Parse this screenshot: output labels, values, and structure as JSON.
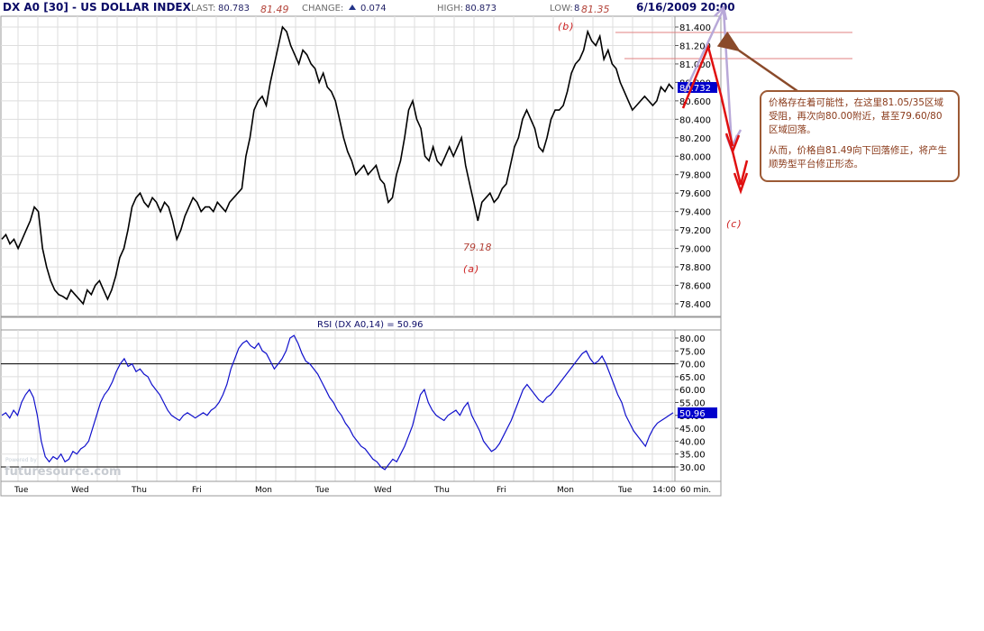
{
  "header": {
    "symbol": "DX A0 [30] - US DOLLAR INDEX",
    "last_label": "LAST:",
    "last_value": "80.783",
    "change_label": "CHANGE:",
    "change_value": "0.074",
    "high_label": "HIGH:",
    "high_value": "80.873",
    "low_label": "LOW:",
    "low_value": "8",
    "datetime": "6/16/2009 20:00"
  },
  "annotations": {
    "peak_high": "81.49",
    "peak_b": "81.35",
    "trough_low": "79.18",
    "wave_a": "(a)",
    "wave_b": "(b)",
    "wave_c": "(c)"
  },
  "note": {
    "paragraph1": "价格存在着可能性，在这里81.05/35区域受阻，再次向80.00附近，甚至79.60/80区域回落。",
    "paragraph2": "从而，价格自81.49向下回落修正，将产生顺势型平台修正形态。"
  },
  "watermark": "futuresource.com",
  "watermark_small": "Powered by",
  "interval_label": "60 min.",
  "colors": {
    "price": "#000000",
    "rsi": "#1010cc",
    "accent_box": "#0000cc",
    "annotation": "#cc2020",
    "note_border": "#9c5a35",
    "forecast_arrow": "#b8a8d8"
  },
  "chart_data": [
    {
      "type": "line",
      "name": "DX A0 price",
      "title": "DX A0 [30] - US DOLLAR INDEX",
      "yticks": [
        "81.400",
        "81.200",
        "81.000",
        "80.800",
        "80.600",
        "80.400",
        "80.200",
        "80.000",
        "79.800",
        "79.600",
        "79.400",
        "79.200",
        "79.000",
        "78.800",
        "78.600",
        "78.400"
      ],
      "ylim": [
        78.3,
        81.5
      ],
      "last_marker": "80.732",
      "x_labels": [
        "Tue",
        "Wed",
        "Thu",
        "Fri",
        "Mon",
        "Tue",
        "Wed",
        "Thu",
        "Fri",
        "Mon",
        "Tue",
        "14:00"
      ],
      "values": [
        79.1,
        79.15,
        79.05,
        79.1,
        79.0,
        79.1,
        79.2,
        79.3,
        79.45,
        79.4,
        79.0,
        78.8,
        78.65,
        78.55,
        78.5,
        78.48,
        78.45,
        78.55,
        78.5,
        78.45,
        78.4,
        78.55,
        78.5,
        78.6,
        78.65,
        78.55,
        78.45,
        78.55,
        78.7,
        78.9,
        79.0,
        79.2,
        79.45,
        79.55,
        79.6,
        79.5,
        79.45,
        79.55,
        79.5,
        79.4,
        79.5,
        79.45,
        79.3,
        79.1,
        79.2,
        79.35,
        79.45,
        79.55,
        79.5,
        79.4,
        79.45,
        79.45,
        79.4,
        79.5,
        79.45,
        79.4,
        79.5,
        79.55,
        79.6,
        79.65,
        80.0,
        80.2,
        80.5,
        80.6,
        80.65,
        80.55,
        80.8,
        81.0,
        81.2,
        81.4,
        81.35,
        81.2,
        81.1,
        81.0,
        81.15,
        81.1,
        81.0,
        80.95,
        80.8,
        80.9,
        80.75,
        80.7,
        80.6,
        80.4,
        80.2,
        80.05,
        79.95,
        79.8,
        79.85,
        79.9,
        79.8,
        79.85,
        79.9,
        79.75,
        79.7,
        79.5,
        79.55,
        79.8,
        79.95,
        80.2,
        80.5,
        80.6,
        80.4,
        80.3,
        80.0,
        79.95,
        80.1,
        79.95,
        79.9,
        80.0,
        80.1,
        80.0,
        80.1,
        80.2,
        79.9,
        79.7,
        79.5,
        79.3,
        79.5,
        79.55,
        79.6,
        79.5,
        79.55,
        79.65,
        79.7,
        79.9,
        80.1,
        80.2,
        80.4,
        80.5,
        80.4,
        80.3,
        80.1,
        80.05,
        80.2,
        80.4,
        80.5,
        80.5,
        80.55,
        80.7,
        80.9,
        81.0,
        81.05,
        81.15,
        81.35,
        81.25,
        81.2,
        81.3,
        81.05,
        81.15,
        81.0,
        80.95,
        80.8,
        80.7,
        80.6,
        80.5,
        80.55,
        80.6,
        80.65,
        80.6,
        80.55,
        80.6,
        80.75,
        80.7,
        80.78,
        80.73
      ]
    },
    {
      "type": "line",
      "name": "RSI (DX A0,14)",
      "title": "RSI (DX A0,14) = 50.96",
      "yticks": [
        "80.00",
        "75.00",
        "70.00",
        "65.00",
        "60.00",
        "55.00",
        "50.00",
        "45.00",
        "40.00",
        "35.00",
        "30.00"
      ],
      "ylim": [
        27,
        82
      ],
      "reference_lines": [
        70,
        30
      ],
      "last_marker": "50.96",
      "values": [
        50,
        51,
        49,
        52,
        50,
        55,
        58,
        60,
        57,
        50,
        40,
        34,
        32,
        34,
        33,
        35,
        32,
        33,
        36,
        35,
        37,
        38,
        40,
        45,
        50,
        55,
        58,
        60,
        63,
        67,
        70,
        72,
        69,
        70,
        67,
        68,
        66,
        65,
        62,
        60,
        58,
        55,
        52,
        50,
        49,
        48,
        50,
        51,
        50,
        49,
        50,
        51,
        50,
        52,
        53,
        55,
        58,
        62,
        68,
        72,
        76,
        78,
        79,
        77,
        76,
        78,
        75,
        74,
        71,
        68,
        70,
        72,
        75,
        80,
        81,
        78,
        74,
        71,
        70,
        68,
        66,
        63,
        60,
        57,
        55,
        52,
        50,
        47,
        45,
        42,
        40,
        38,
        37,
        35,
        33,
        32,
        30,
        29,
        31,
        33,
        32,
        35,
        38,
        42,
        46,
        52,
        58,
        60,
        55,
        52,
        50,
        49,
        48,
        50,
        51,
        52,
        50,
        53,
        55,
        50,
        47,
        44,
        40,
        38,
        36,
        37,
        39,
        42,
        45,
        48,
        52,
        56,
        60,
        62,
        60,
        58,
        56,
        55,
        57,
        58,
        60,
        62,
        64,
        66,
        68,
        70,
        72,
        74,
        75,
        72,
        70,
        71,
        73,
        70,
        66,
        62,
        58,
        55,
        50,
        47,
        44,
        42,
        40,
        38,
        42,
        45,
        47,
        48,
        49,
        50,
        51
      ]
    }
  ]
}
